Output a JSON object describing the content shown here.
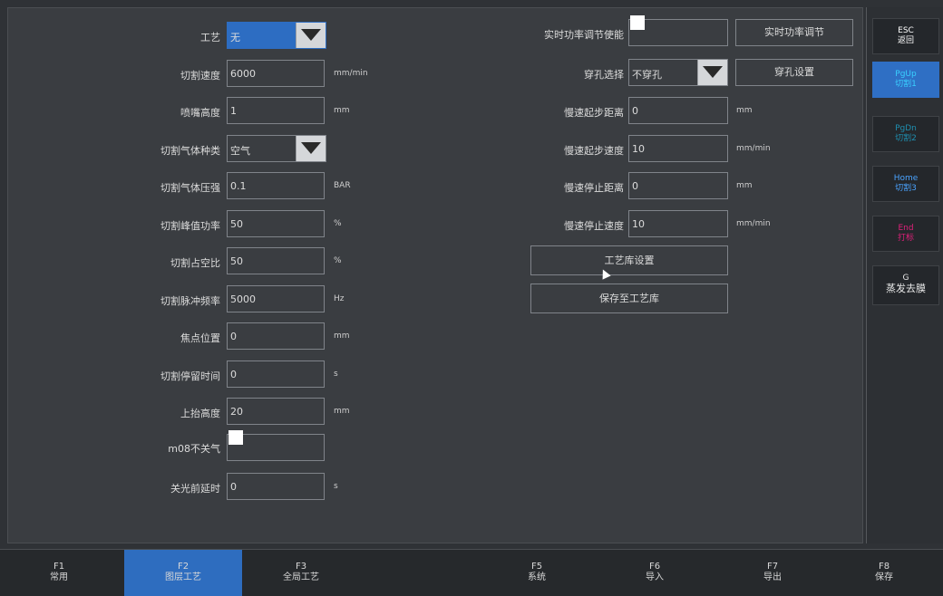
{
  "colors": {
    "accent": "#2d6dc2",
    "esc": "#ffffff",
    "pgup": "#39d0ff",
    "pgdn": "#1f8fb0",
    "home": "#4aa3ff",
    "end": "#e0207a"
  },
  "left_rows": [
    {
      "label": "工艺",
      "value": "无",
      "kind": "combo-selected"
    },
    {
      "label": "切割速度",
      "value": "6000",
      "unit": "mm/min"
    },
    {
      "label": "喷嘴高度",
      "value": "1",
      "unit": "mm"
    },
    {
      "label": "切割气体种类",
      "value": "空气",
      "kind": "combo"
    },
    {
      "label": "切割气体压强",
      "value": "0.1",
      "unit": "BAR"
    },
    {
      "label": "切割峰值功率",
      "value": "50",
      "unit": "%"
    },
    {
      "label": "切割占空比",
      "value": "50",
      "unit": "%"
    },
    {
      "label": "切割脉冲频率",
      "value": "5000",
      "unit": "Hz"
    },
    {
      "label": "焦点位置",
      "value": "0",
      "unit": "mm"
    },
    {
      "label": "切割停留时间",
      "value": "0",
      "unit": "s"
    },
    {
      "label": "上抬高度",
      "value": "20",
      "unit": "mm"
    },
    {
      "label": "m08不关气",
      "value": "",
      "kind": "checkbox"
    },
    {
      "label": "关光前延时",
      "value": "0",
      "unit": "s"
    }
  ],
  "right_rows": [
    {
      "label": "实时功率调节使能",
      "kind": "checkbox",
      "button": "实时功率调节"
    },
    {
      "label": "穿孔选择",
      "value": "不穿孔",
      "kind": "combo",
      "button": "穿孔设置"
    },
    {
      "label": "慢速起步距离",
      "value": "0",
      "unit": "mm"
    },
    {
      "label": "慢速起步速度",
      "value": "10",
      "unit": "mm/min"
    },
    {
      "label": "慢速停止距离",
      "value": "0",
      "unit": "mm"
    },
    {
      "label": "慢速停止速度",
      "value": "10",
      "unit": "mm/min"
    }
  ],
  "actions": {
    "lib_settings": "工艺库设置",
    "save_to_lib": "保存至工艺库"
  },
  "side": [
    {
      "key": "ESC",
      "label": "返回"
    },
    {
      "key": "PgUp",
      "label": "切割1"
    },
    {
      "key": "PgDn",
      "label": "切割2"
    },
    {
      "key": "Home",
      "label": "切割3"
    },
    {
      "key": "End",
      "label": "打标"
    },
    {
      "key": "G",
      "label": "蒸发去膜"
    }
  ],
  "tabs": [
    {
      "key": "F1",
      "label": "常用"
    },
    {
      "key": "F2",
      "label": "图层工艺"
    },
    {
      "key": "F3",
      "label": "全局工艺"
    },
    {
      "key": "",
      "label": ""
    },
    {
      "key": "F5",
      "label": "系统"
    },
    {
      "key": "F6",
      "label": "导入"
    },
    {
      "key": "F7",
      "label": "导出"
    },
    {
      "key": "F8",
      "label": "保存"
    }
  ]
}
